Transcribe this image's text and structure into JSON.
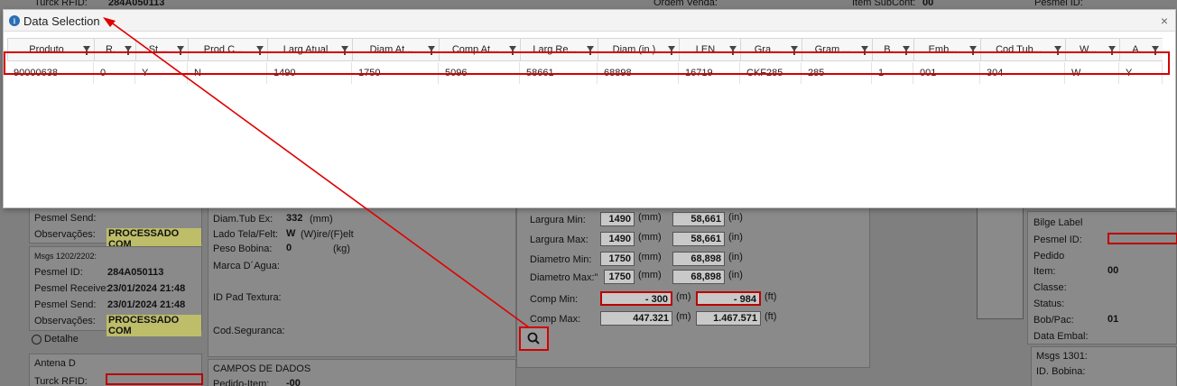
{
  "modal": {
    "title": "Data Selection",
    "close_label": "×",
    "columns": [
      "Produto",
      "R.",
      "St...",
      "Prod C...",
      "Larg Atual",
      "Diam At...",
      "Comp At...",
      "Larg Re...",
      "Diam (in.)",
      "LEN",
      "Gra...",
      "Gram ...",
      "B.",
      "Emb...",
      "Cod Tub...",
      "W...",
      "A."
    ],
    "row": [
      "90000638",
      "0",
      "Y",
      "N",
      "1490",
      "1750",
      "5096",
      "58661",
      "68898",
      "16719",
      "CKF285",
      "285",
      "1",
      "001",
      "304",
      "W",
      "Y"
    ]
  },
  "bg": {
    "top_left_label": "Turck RFID:",
    "top_left_value": "284A050113",
    "ordem_venda": "Ordem Venda:",
    "item_subcont": "Item SubCont:",
    "item_subcont_val": "00",
    "pesmel_id_top": "Pesmel ID:",
    "left1": {
      "pesmel_send": "Pesmel Send:",
      "observacoes": "Observações:",
      "obs_val": "PROCESSADO COM"
    },
    "left2": {
      "msgs": "Msgs 1202/2202:",
      "pesmel_id": "Pesmel ID:",
      "pesmel_id_val": "284A050113",
      "pesmel_receive": "Pesmel Receive:",
      "pesmel_receive_val": "23/01/2024 21:48",
      "pesmel_send": "Pesmel Send:",
      "pesmel_send_val": "23/01/2024 21:48",
      "observacoes": "Observações:",
      "obs_val": "PROCESSADO COM",
      "detalhe": "Detalhe"
    },
    "left3": {
      "antena": "Antena D",
      "turck": "Turck RFID:"
    },
    "mid": {
      "diam_tub": "Diam.Tub Ex:",
      "diam_tub_val": "332",
      "diam_tub_unit": "(mm)",
      "lado": "Lado Tela/Felt:",
      "lado_val": "W",
      "lado_hint": "(W)ire/(F)elt",
      "peso": "Peso Bobina:",
      "peso_val": "0",
      "peso_unit": "(kg)",
      "marca": "Marca D´Agua:",
      "id_pad": "ID Pad Textura:",
      "cod_seg": "Cod.Seguranca:",
      "campos": "CAMPOS DE DADOS",
      "pedido_item": "Pedido-Item:",
      "pedido_item_val": "-00"
    },
    "filter": {
      "largura_min": "Largura Min:",
      "largura_min_mm": "1490",
      "largura_min_in": "58,661",
      "largura_max": "Largura Max:",
      "largura_max_mm": "1490",
      "largura_max_in": "58,661",
      "diametro_min": "Diametro Min:",
      "diametro_min_mm": "1750",
      "diametro_min_in": "68,898",
      "diametro_max": "Diametro Max:\"",
      "diametro_max_mm": "1750",
      "diametro_max_in": "68,898",
      "comp_min": "Comp Min:",
      "comp_min_m": "- 300",
      "comp_min_ft": "- 984",
      "comp_max": "Comp Max:",
      "comp_max_m": "447.321",
      "comp_max_ft": "1.467.571",
      "u_mm": "(mm)",
      "u_in": "(in)",
      "u_m": "(m)",
      "u_ft": "(ft)"
    },
    "right": {
      "bilge": "Bilge Label",
      "pesmel_id": "Pesmel ID:",
      "pedido": "Pedido",
      "item": "Item:",
      "item_val": "00",
      "classe": "Classe:",
      "status": "Status:",
      "bob_pac": "Bob/Pac:",
      "bob_pac_val": "01",
      "data_embal": "Data Embal:",
      "msgs1301": "Msgs 1301:",
      "id_bobina": "ID. Bobina:"
    }
  }
}
